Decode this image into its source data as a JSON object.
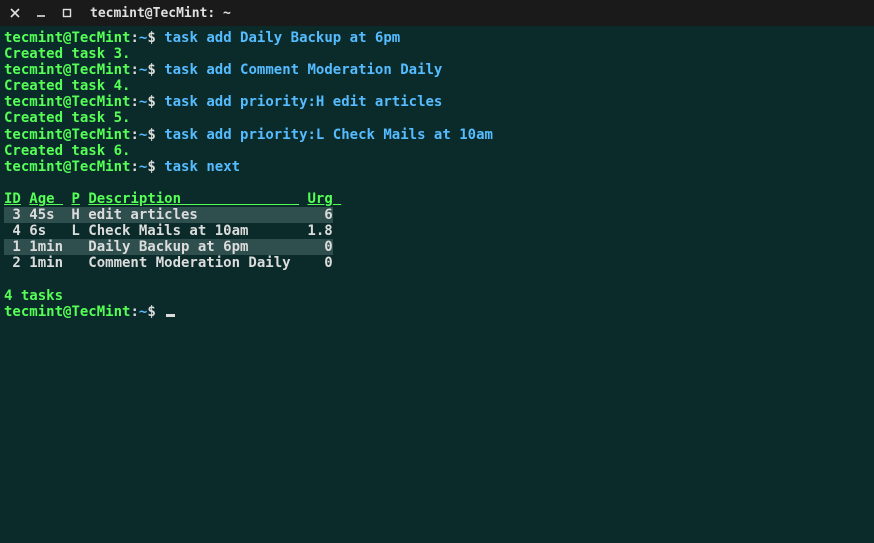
{
  "titlebar": {
    "title": "tecmint@TecMint: ~"
  },
  "prompt": {
    "user": "tecmint",
    "at": "@",
    "host": "TecMint",
    "sep": ":",
    "path": "~",
    "symbol": "$"
  },
  "commands": [
    {
      "cmd": "task add Daily Backup at 6pm",
      "out": "Created task 3."
    },
    {
      "cmd": "task add Comment Moderation Daily",
      "out": "Created task 4."
    },
    {
      "cmd": "task add priority:H edit articles",
      "out": "Created task 5."
    },
    {
      "cmd": "task add priority:L Check Mails at 10am",
      "out": "Created task 6."
    },
    {
      "cmd": "task next",
      "out": ""
    }
  ],
  "table": {
    "headers": {
      "id": "ID",
      "age": "Age ",
      "p": "P",
      "desc": "Description              ",
      "urg": "Urg "
    },
    "rows": [
      {
        "id": " 3",
        "age": "45s ",
        "p": "H",
        "desc": "edit articles            ",
        "urg": "  6",
        "hi": true
      },
      {
        "id": " 4",
        "age": "6s  ",
        "p": "L",
        "desc": "Check Mails at 10am      ",
        "urg": "1.8",
        "hi": false
      },
      {
        "id": " 1",
        "age": "1min",
        "p": " ",
        "desc": "Daily Backup at 6pm      ",
        "urg": "  0",
        "hi": true
      },
      {
        "id": " 2",
        "age": "1min",
        "p": " ",
        "desc": "Comment Moderation Daily ",
        "urg": "  0",
        "hi": false
      }
    ]
  },
  "footer": "4 tasks"
}
